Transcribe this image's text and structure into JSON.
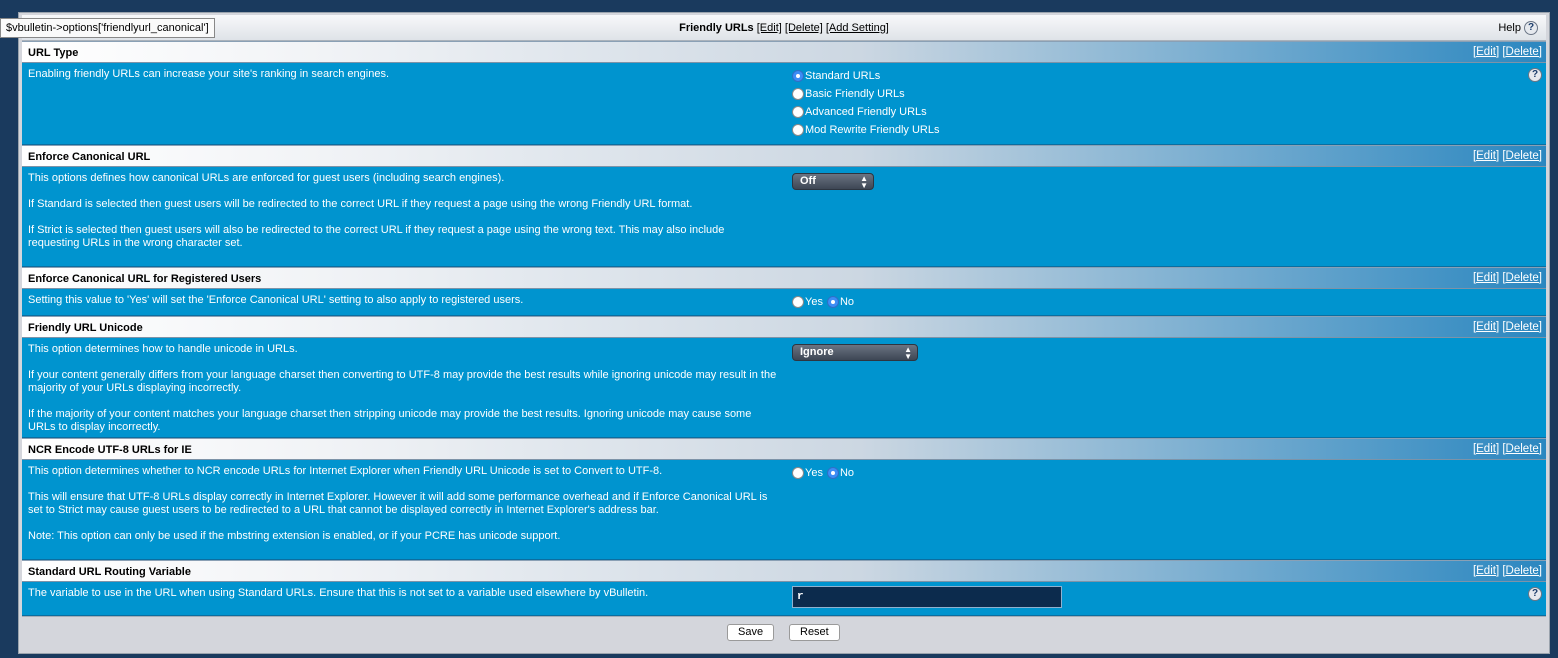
{
  "tooltip": "$vbulletin->options['friendlyurl_canonical']",
  "topbar": {
    "title": "Friendly URLs",
    "edit": "[Edit]",
    "delete": "[Delete]",
    "add_setting": "[Add Setting]",
    "help": "Help"
  },
  "common": {
    "edit": "[Edit]",
    "delete": "[Delete]",
    "qmark": "?"
  },
  "settings": [
    {
      "title": "URL Type",
      "desc": [
        "Enabling friendly URLs can increase your site's ranking in search engines."
      ],
      "options": [
        "Standard URLs",
        "Basic Friendly URLs",
        "Advanced Friendly URLs",
        "Mod Rewrite Friendly URLs"
      ],
      "selected": "Standard URLs"
    },
    {
      "title": "Enforce Canonical URL",
      "desc": [
        "This options defines how canonical URLs are enforced for guest users (including search engines).",
        "If Standard is selected then guest users will be redirected to the correct URL if they request a page using the wrong Friendly URL format.",
        "If Strict is selected then guest users will also be redirected to the correct URL if they request a page using the wrong text. This may also include requesting URLs in the wrong character set."
      ],
      "select_value": "Off"
    },
    {
      "title": "Enforce Canonical URL for Registered Users",
      "desc": [
        "Setting this value to 'Yes' will set the 'Enforce Canonical URL' setting to also apply to registered users."
      ],
      "yes": "Yes",
      "no": "No",
      "selected": "No"
    },
    {
      "title": "Friendly URL Unicode",
      "desc": [
        "This option determines how to handle unicode in URLs.",
        "If your content generally differs from your language charset then converting to UTF-8 may provide the best results while ignoring unicode may result in the majority of your URLs displaying incorrectly.",
        "If the majority of your content matches your language charset then stripping unicode may provide the best results. Ignoring unicode may cause some URLs to display incorrectly."
      ],
      "select_value": "Ignore"
    },
    {
      "title": "NCR Encode UTF-8 URLs for IE",
      "desc": [
        "This option determines whether to NCR encode URLs for Internet Explorer when Friendly URL Unicode is set to Convert to UTF-8.",
        "This will ensure that UTF-8 URLs display correctly in Internet Explorer. However it will add some performance overhead and if Enforce Canonical URL is set to Strict may cause guest users to be redirected to a URL that cannot be displayed correctly in Internet Explorer's address bar.",
        "Note: This option can only be used if the mbstring extension is enabled, or if your PCRE has unicode support."
      ],
      "yes": "Yes",
      "no": "No",
      "selected": "No"
    },
    {
      "title": "Standard URL Routing Variable",
      "desc": [
        "The variable to use in the URL when using Standard URLs. Ensure that this is not set to a variable used elsewhere by vBulletin."
      ],
      "input_value": "r"
    }
  ],
  "footer": {
    "save": "Save",
    "reset": "Reset"
  }
}
